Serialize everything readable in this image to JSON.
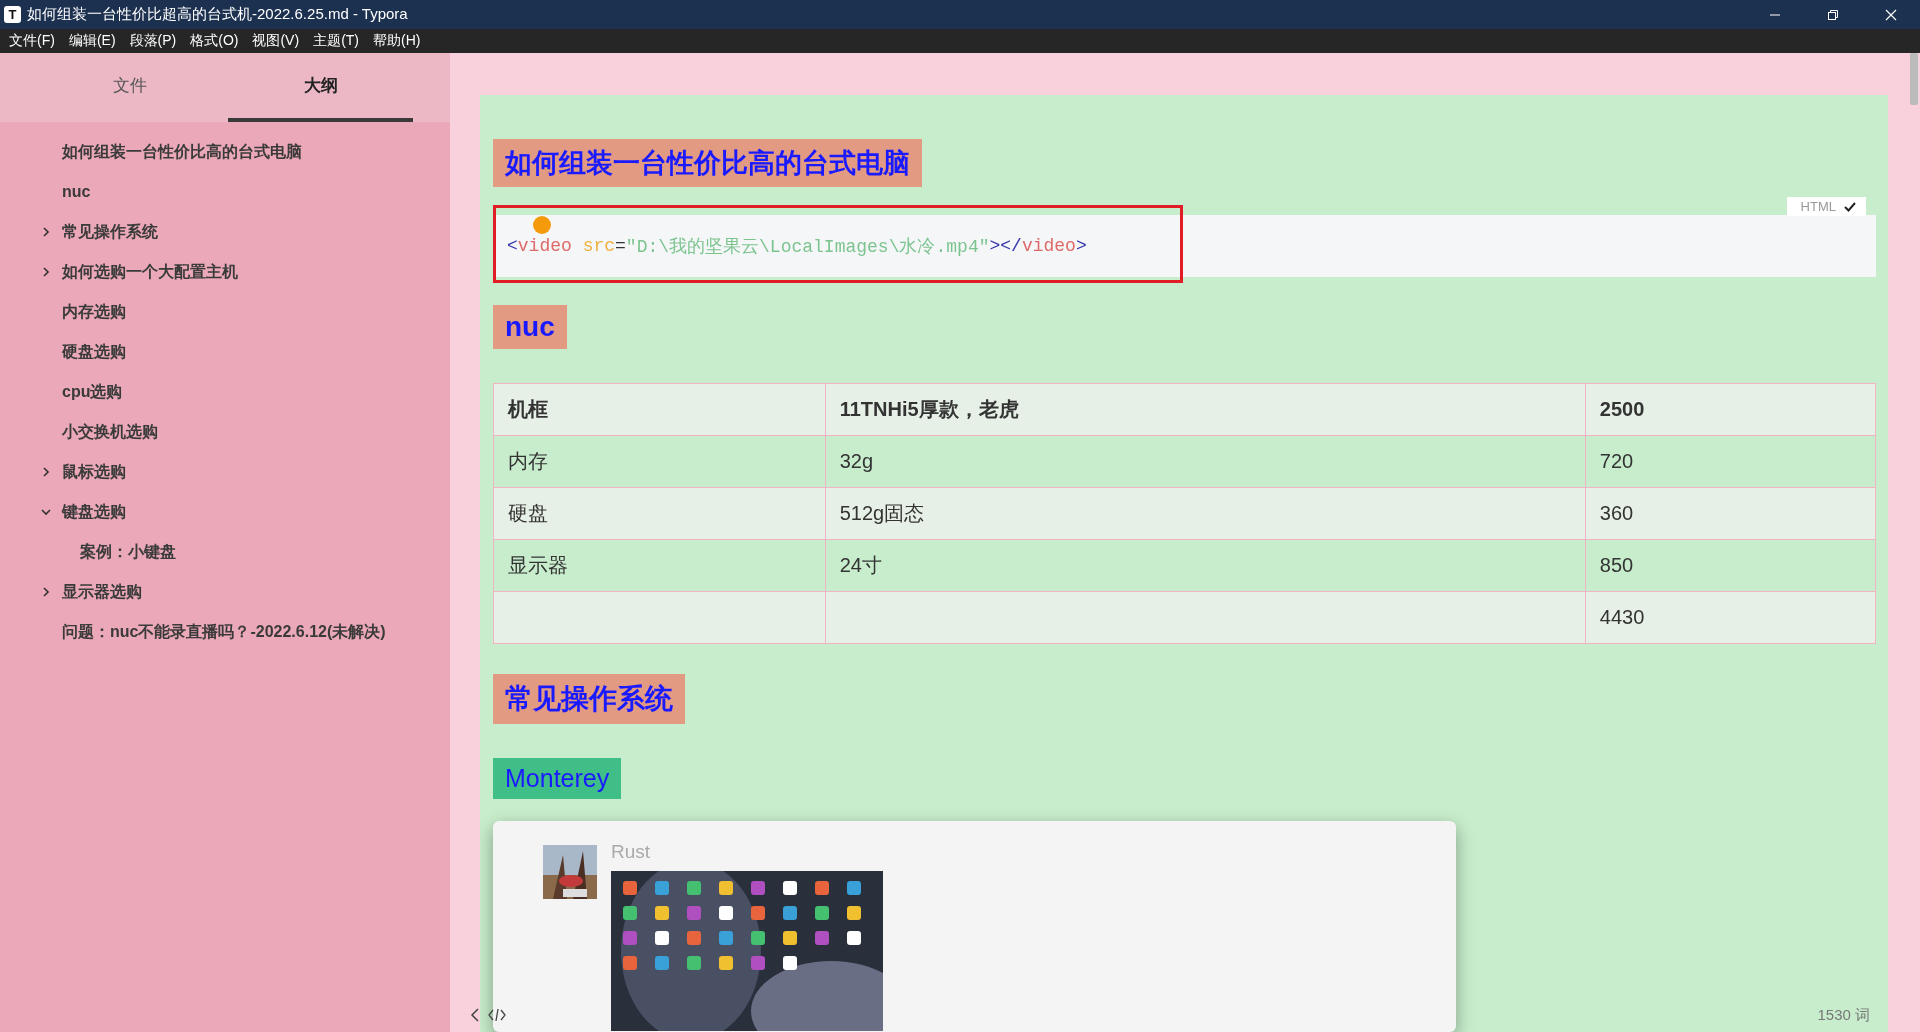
{
  "window": {
    "app_icon": "T",
    "title": "如何组装一台性价比超高的台式机-2022.6.25.md - Typora"
  },
  "menu": [
    "文件(F)",
    "编辑(E)",
    "段落(P)",
    "格式(O)",
    "视图(V)",
    "主题(T)",
    "帮助(H)"
  ],
  "sidebar": {
    "tabs": [
      {
        "label": "文件",
        "selected": false
      },
      {
        "label": "大纲",
        "selected": true
      }
    ],
    "outline": [
      {
        "kind": "leaf",
        "label": "如何组装一台性价比高的台式电脑"
      },
      {
        "kind": "leaf",
        "label": "nuc"
      },
      {
        "kind": "branch",
        "label": "常见操作系统",
        "expanded": false
      },
      {
        "kind": "branch",
        "label": "如何选购一个大配置主机",
        "expanded": false
      },
      {
        "kind": "leaf",
        "label": "内存选购"
      },
      {
        "kind": "leaf",
        "label": "硬盘选购"
      },
      {
        "kind": "leaf",
        "label": "cpu选购"
      },
      {
        "kind": "leaf",
        "label": "小交换机选购"
      },
      {
        "kind": "branch",
        "label": "鼠标选购",
        "expanded": false
      },
      {
        "kind": "branch",
        "label": "键盘选购",
        "expanded": true,
        "children": [
          {
            "label": "案例：小键盘"
          }
        ]
      },
      {
        "kind": "branch",
        "label": "显示器选购",
        "expanded": false
      },
      {
        "kind": "leaf",
        "label": "问题：nuc不能录直播吗？-2022.6.12(未解决)"
      }
    ]
  },
  "document": [
    {
      "kind": "title",
      "text": "如何组装一台性价比高的台式电脑"
    },
    {
      "kind": "code",
      "language": "HTML",
      "highlighted": true,
      "tokens": [
        {
          "kind": "punct",
          "text": "<"
        },
        {
          "kind": "tag",
          "text": "video"
        },
        {
          "kind": "attr",
          "text": "src"
        },
        {
          "kind": "op",
          "text": "="
        },
        {
          "kind": "string",
          "text": "\"D:\\我的坚果云\\LocalImages\\水冷.mp4\""
        },
        {
          "kind": "punct",
          "text": "></"
        },
        {
          "kind": "tag",
          "text": "video"
        },
        {
          "kind": "punct",
          "text": ">"
        }
      ]
    },
    {
      "kind": "heading",
      "text": "nuc"
    },
    {
      "kind": "table",
      "header": [
        "机框",
        "11TNHi5厚款，老虎",
        "2500"
      ],
      "rows": [
        [
          "内存",
          "32g",
          "720"
        ],
        [
          "硬盘",
          "512g固态",
          "360"
        ],
        [
          "显示器",
          "24寸",
          "850"
        ],
        [
          "",
          "",
          "4430"
        ]
      ]
    },
    {
      "kind": "heading",
      "text": "常见操作系统"
    },
    {
      "kind": "subheading",
      "text": "Monterey"
    },
    {
      "kind": "image_card",
      "caption": "Rust"
    }
  ],
  "status_bar": {
    "word_count": "1530 词"
  }
}
